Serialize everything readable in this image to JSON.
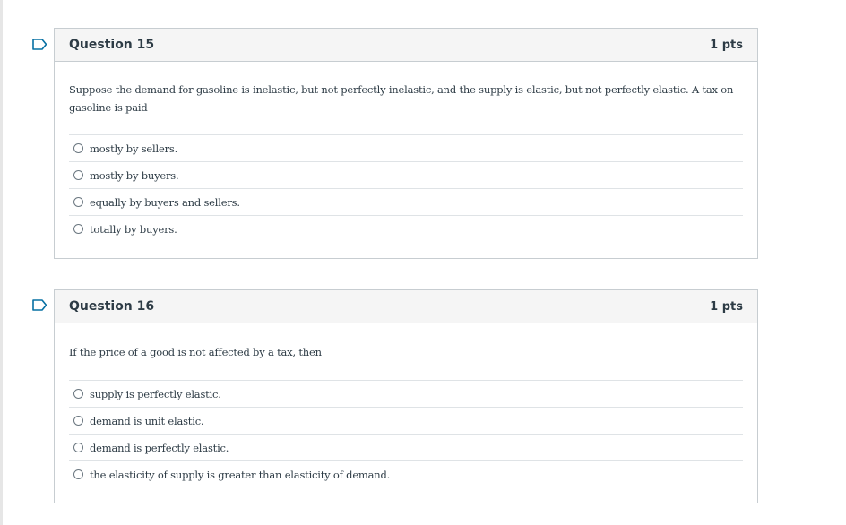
{
  "questions": [
    {
      "title": "Question 15",
      "points": "1 pts",
      "text": "Suppose the demand for gasoline is inelastic, but not perfectly inelastic, and the supply is elastic, but not perfectly elastic. A tax on gasoline is paid",
      "answers": [
        "mostly by sellers.",
        "mostly by buyers.",
        "equally by buyers and sellers.",
        "totally by buyers."
      ]
    },
    {
      "title": "Question 16",
      "points": "1 pts",
      "text": "If the price of a good is not affected by a tax, then",
      "answers": [
        "supply is perfectly elastic.",
        "demand is unit elastic.",
        "demand is perfectly elastic.",
        "the elasticity of supply is greater than elasticity of demand."
      ]
    }
  ],
  "icons": {
    "bookmark": "bookmark-icon",
    "radio": "radio-button"
  },
  "colors": {
    "accent": "#0770a3",
    "border": "#c7cdd1",
    "header_bg": "#f5f5f5",
    "text": "#2d3b45"
  }
}
